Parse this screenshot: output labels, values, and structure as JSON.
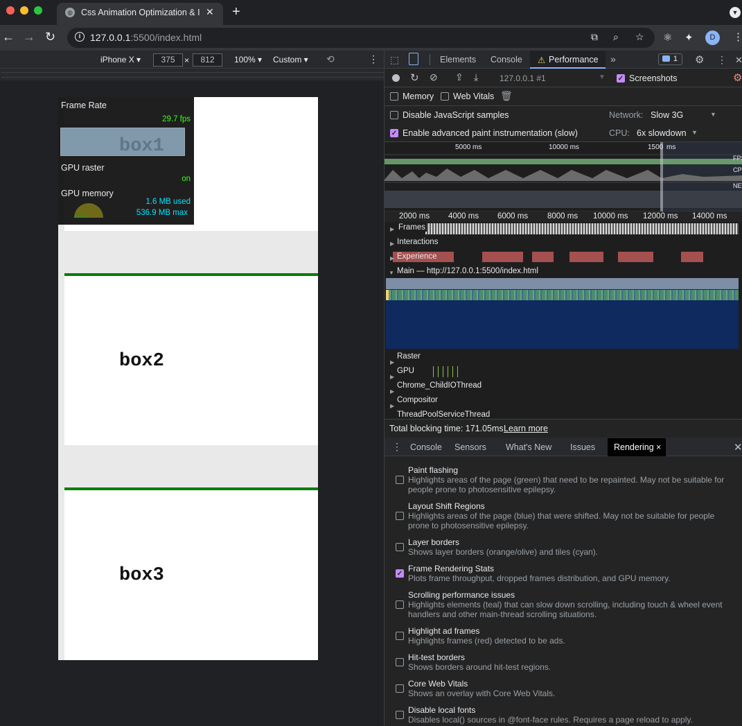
{
  "browser": {
    "tab_title": "Css Animation Optimization & I",
    "tab_favicon": "globe-icon",
    "url_host": "127.0.0.1",
    "url_rest": ":5500/index.html",
    "profile_initial": "D"
  },
  "device_toolbar": {
    "device": "iPhone X",
    "width": "375",
    "height": "812",
    "times": "×",
    "zoom": "100%",
    "throttle": "Custom"
  },
  "page": {
    "box1": "box1",
    "box2": "box2",
    "box3": "box3"
  },
  "frame_stats": {
    "frame_rate_label": "Frame Rate",
    "fps": "29.7 fps",
    "gpu_raster_label": "GPU raster",
    "gpu_raster_value": "on",
    "gpu_memory_label": "GPU memory",
    "memory_used": "1.6 MB used",
    "memory_max": "536.9 MB max",
    "gauge_fraction": 0.003
  },
  "devtools": {
    "tabs": [
      "Elements",
      "Console",
      "Performance"
    ],
    "performance_warning": "⚠",
    "issues_count": "1",
    "profile_select": "127.0.0.1 #1",
    "screenshots_label": "Screenshots",
    "screenshots_checked": true,
    "memory_label": "Memory",
    "web_vitals_label": "Web Vitals",
    "disable_js_label": "Disable JavaScript samples",
    "network_label": "Network:",
    "network_value": "Slow 3G",
    "paint_instr_label": "Enable advanced paint instrumentation (slow)",
    "cpu_label": "CPU:",
    "cpu_value": "6x slowdown",
    "overview_ticks": [
      "5000 ms",
      "10000 ms",
      "1500",
      "ms"
    ],
    "overview_side": [
      "FPS",
      "CPU",
      "NET"
    ],
    "ruler_ticks": [
      "2000 ms",
      "4000 ms",
      "6000 ms",
      "8000 ms",
      "10000 ms",
      "12000 ms",
      "14000 ms"
    ],
    "tracks": [
      "Frames",
      "Interactions",
      "Experience",
      "Main — http://127.0.0.1:5500/index.html",
      "Raster",
      "GPU",
      "Chrome_ChildIOThread",
      "Compositor",
      "ThreadPoolServiceThread"
    ],
    "tbt_label": "Total blocking time: 171.05ms",
    "learn_more": "Learn more"
  },
  "drawer": {
    "tabs": [
      "Console",
      "Sensors",
      "What's New",
      "Issues",
      "Rendering"
    ],
    "close": "×",
    "options": [
      {
        "title": "Paint flashing",
        "desc": "Highlights areas of the page (green) that need to be repainted. May not be suitable for people prone to photosensitive epilepsy.",
        "checked": false
      },
      {
        "title": "Layout Shift Regions",
        "desc": "Highlights areas of the page (blue) that were shifted. May not be suitable for people prone to photosensitive epilepsy.",
        "checked": false
      },
      {
        "title": "Layer borders",
        "desc": "Shows layer borders (orange/olive) and tiles (cyan).",
        "checked": false
      },
      {
        "title": "Frame Rendering Stats",
        "desc": "Plots frame throughput, dropped frames distribution, and GPU memory.",
        "checked": true
      },
      {
        "title": "Scrolling performance issues",
        "desc": "Highlights elements (teal) that can slow down scrolling, including touch & wheel event handlers and other main-thread scrolling situations.",
        "checked": false
      },
      {
        "title": "Highlight ad frames",
        "desc": "Highlights frames (red) detected to be ads.",
        "checked": false
      },
      {
        "title": "Hit-test borders",
        "desc": "Shows borders around hit-test regions.",
        "checked": false
      },
      {
        "title": "Core Web Vitals",
        "desc": "Shows an overlay with Core Web Vitals.",
        "checked": false
      },
      {
        "title": "Disable local fonts",
        "desc": "Disables local() sources in @font-face rules. Requires a page reload to apply.",
        "checked": false
      }
    ]
  },
  "colors": {
    "accent": "#8ab4f8",
    "checkbox": "#c58af9",
    "fps_green": "#39ff14",
    "mem_cyan": "#00e5ff",
    "green_border": "#008000",
    "main_track": "#0f2a5e"
  }
}
